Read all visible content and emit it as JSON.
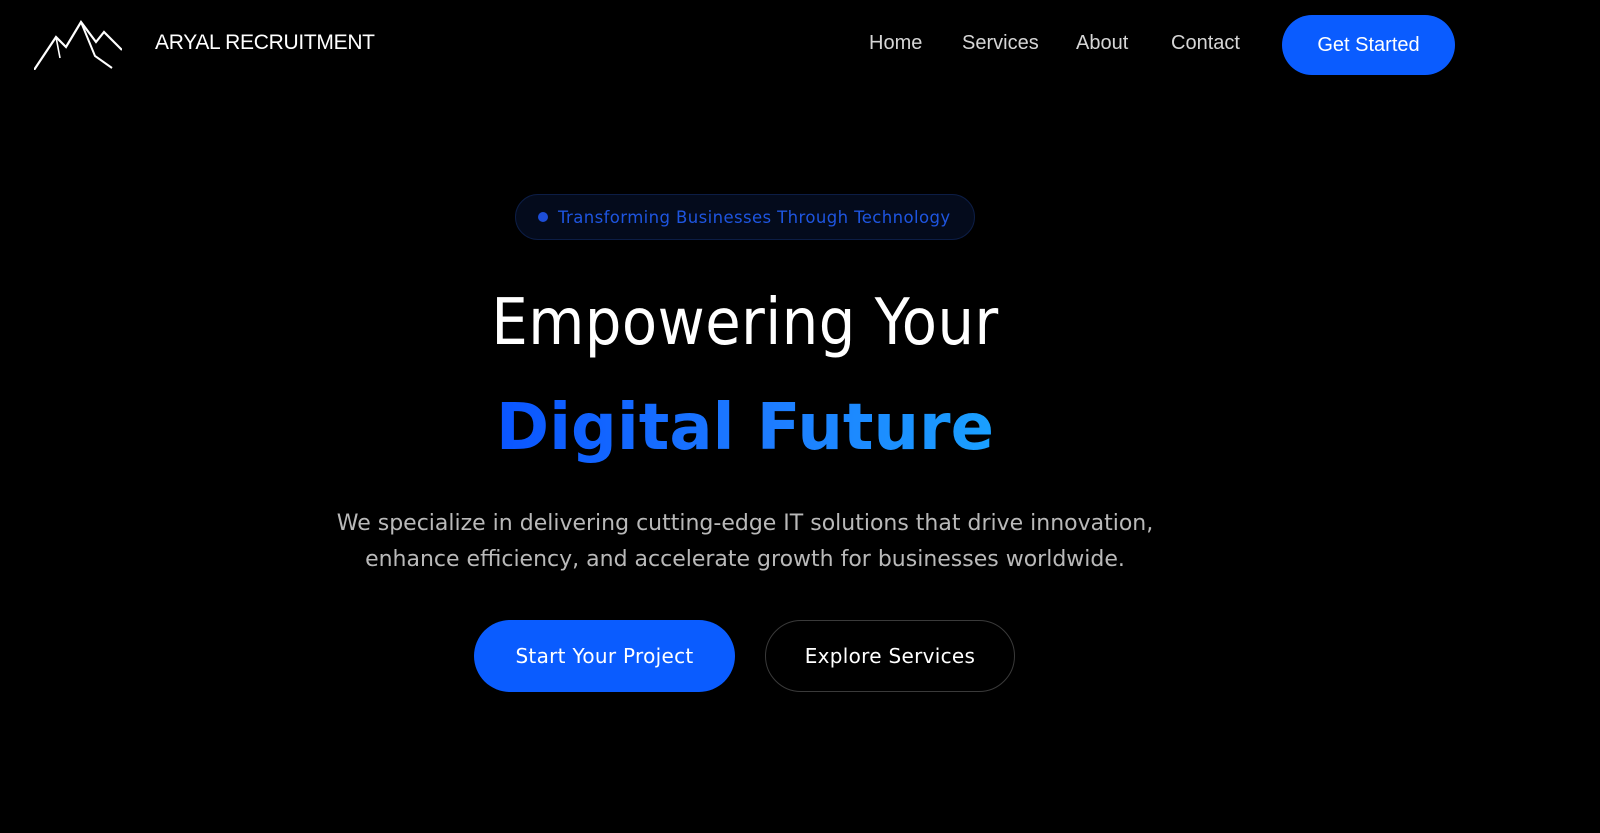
{
  "header": {
    "brand_name": "ARYAL RECRUITMENT",
    "logo_icon": "mountain-peaks-icon",
    "nav": {
      "home": "Home",
      "services": "Services",
      "about": "About",
      "contact": "Contact"
    },
    "cta_label": "Get Started"
  },
  "hero": {
    "badge_text": "Transforming Businesses Through Technology",
    "title_line1": "Empowering Your",
    "title_line2": "Digital Future",
    "description_line1": "We specialize in delivering cutting-edge IT solutions that drive innovation,",
    "description_line2": "enhance efficiency, and accelerate growth for businesses worldwide.",
    "primary_button": "Start Your Project",
    "secondary_button": "Explore Services"
  },
  "colors": {
    "background": "#000000",
    "accent": "#0a5cff",
    "gradient_end": "#1aa0ff",
    "badge_text": "#1e55e0",
    "body_text": "#b9b9b9"
  }
}
